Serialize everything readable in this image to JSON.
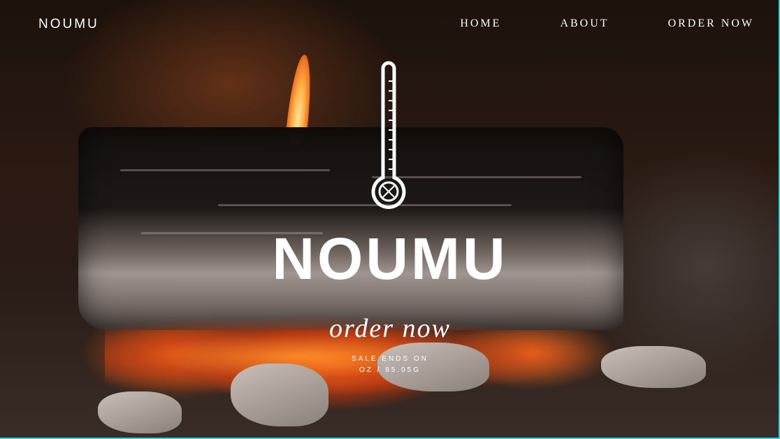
{
  "header": {
    "brand": "NOUMU",
    "nav": [
      "HOME",
      "ABOUT",
      "ORDER NOW"
    ]
  },
  "hero": {
    "icon": "thermometer-icon",
    "title": "NOUMU",
    "cta": "order now",
    "sale_line1": "SALE ENDS ON",
    "sale_line2": "OZ / 85.05G"
  },
  "colors": {
    "text": "#ffffff",
    "frame_accent": "#33d4e0"
  }
}
